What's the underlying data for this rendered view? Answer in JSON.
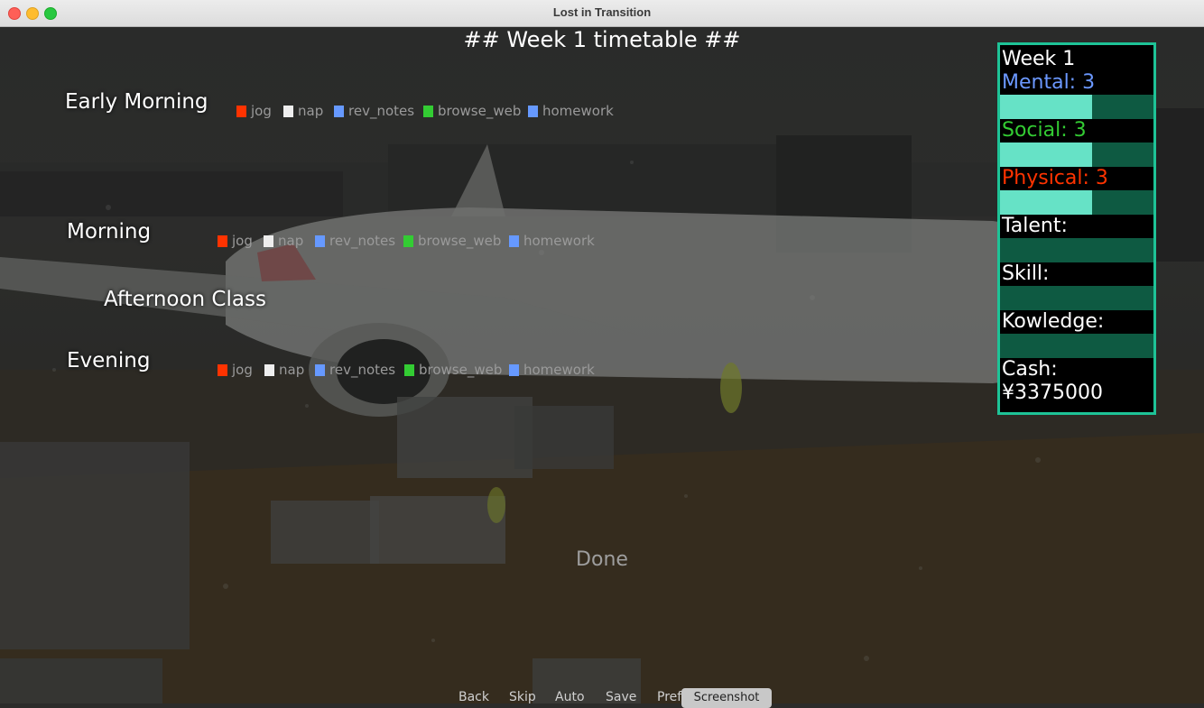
{
  "window": {
    "title": "Lost in Transition"
  },
  "timetable": {
    "title": "## Week 1 timetable ##",
    "slots": [
      {
        "label": "Early Morning",
        "options": [
          "jog",
          "nap",
          "rev_notes",
          "browse_web",
          "homework"
        ]
      },
      {
        "label": "Morning",
        "options": [
          "jog",
          "nap",
          "rev_notes",
          "browse_web",
          "homework"
        ]
      },
      {
        "label": "Afternoon Class"
      },
      {
        "label": "Evening",
        "options": [
          "jog",
          "nap",
          "rev_notes",
          "browse_web",
          "homework"
        ]
      }
    ],
    "option_colors": {
      "jog": "#ff3300",
      "nap": "#eeeeee",
      "rev_notes": "#6699ff",
      "browse_web": "#33cc33",
      "homework": "#6699ff"
    },
    "done_label": "Done"
  },
  "stats": {
    "week": "Week 1",
    "mental": {
      "label": "Mental: 3",
      "color": "#6b98ff",
      "level": 0.6
    },
    "social": {
      "label": "Social: 3",
      "color": "#33cc33",
      "level": 0.6
    },
    "physical": {
      "label": "Physical: 3",
      "color": "#ff3300",
      "level": 0.6
    },
    "talent": {
      "label": "Talent:",
      "level": 0
    },
    "skill": {
      "label": "Skill:",
      "level": 0
    },
    "knowledge": {
      "label": "Kowledge:",
      "level": 0
    },
    "cash_label": "Cash:",
    "cash_value": "¥3375000"
  },
  "quick_menu": {
    "back": "Back",
    "skip": "Skip",
    "auto": "Auto",
    "save": "Save",
    "prefs": "Pref",
    "screenshot": "Screenshot"
  }
}
